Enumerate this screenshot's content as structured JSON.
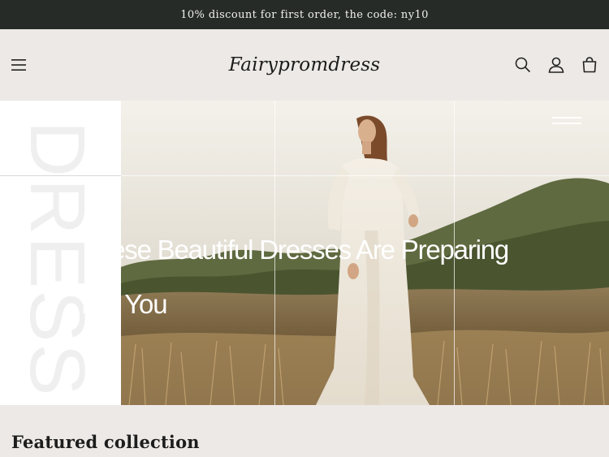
{
  "announcement": {
    "text": "10% discount for first order, the code: ny10"
  },
  "header": {
    "logo_text": "Fairypromdress",
    "icons": [
      "menu-icon",
      "search-icon",
      "account-icon",
      "cart-icon"
    ]
  },
  "hero": {
    "vertical_text": "DRESS",
    "headline_line1": "These Beautiful Dresses Are Preparing",
    "headline_line2": "For You"
  },
  "featured": {
    "title": "Featured collection"
  },
  "colors": {
    "announcement_bg": "#262b28",
    "page_bg": "#ece9e6",
    "text": "#1f1f1f"
  }
}
